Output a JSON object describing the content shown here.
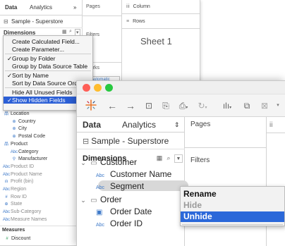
{
  "bg": {
    "tabs": {
      "data": "Data",
      "analytics": "Analytics",
      "arrow": "»",
      "pages": "Pages",
      "columns": "Column",
      "rows": "Rows"
    },
    "datasource": "Sample - Superstore",
    "dimensions": "Dimensions",
    "menu": [
      {
        "label": "Create Calculated Field...",
        "checked": false
      },
      {
        "label": "Create Parameter...",
        "checked": false
      },
      {
        "label": "Group by Folder",
        "checked": true
      },
      {
        "label": "Group by Data Source Table",
        "checked": false
      },
      {
        "label": "Sort by Name",
        "checked": true
      },
      {
        "label": "Sort by Data Source Order",
        "checked": false
      },
      {
        "label": "Hide All Unused Fields",
        "checked": false
      },
      {
        "label": "Show Hidden Fields",
        "checked": true
      }
    ],
    "check": "✓",
    "tree": [
      {
        "label": "Location",
        "icon": "品",
        "indent": 1
      },
      {
        "label": "Country",
        "icon": "⊕",
        "indent": 2
      },
      {
        "label": "City",
        "icon": "⊕",
        "indent": 2
      },
      {
        "label": "Postal Code",
        "icon": "⊕",
        "indent": 2
      },
      {
        "label": "Product",
        "icon": "品",
        "indent": 1
      },
      {
        "label": "Category",
        "icon": "Abc",
        "indent": 2
      },
      {
        "label": "Manufacturer",
        "icon": "⚲",
        "indent": 2
      },
      {
        "label": "Product ID",
        "icon": "Abc",
        "indent": 1,
        "hidden": true
      },
      {
        "label": "Product Name",
        "icon": "Abc",
        "indent": 1,
        "hidden": true
      },
      {
        "label": "Profit (bin)",
        "icon": "ılı",
        "indent": 1,
        "hidden": true
      },
      {
        "label": "Region",
        "icon": "Abc",
        "indent": 1,
        "hidden": true
      },
      {
        "label": "Row ID",
        "icon": "#",
        "indent": 1,
        "hidden": true
      },
      {
        "label": "State",
        "icon": "⊕",
        "indent": 1,
        "hidden": true
      },
      {
        "label": "Sub-Category",
        "icon": "Abc",
        "indent": 1,
        "hidden": true
      },
      {
        "label": "Measure Names",
        "icon": "Abc",
        "indent": 1,
        "hidden": true
      }
    ],
    "measures": "Measures",
    "discount": "Discount",
    "filters": "Filters",
    "marks": "Marks",
    "automatic": "Automatic",
    "sheet": "Sheet 1"
  },
  "fg": {
    "tabs": {
      "data": "Data",
      "analytics": "Analytics",
      "arrow": "⇕",
      "pages": "Pages"
    },
    "datasource": "Sample - Superstore",
    "dimensions": "Dimensions",
    "filters": "Filters",
    "tree": [
      {
        "label": "Customer",
        "type": "folder",
        "open": true
      },
      {
        "label": "Customer Name",
        "type": "abc"
      },
      {
        "label": "Segment",
        "type": "abc",
        "selected": true
      },
      {
        "label": "Order",
        "type": "folder",
        "open": true
      },
      {
        "label": "Order Date",
        "type": "date"
      },
      {
        "label": "Order ID",
        "type": "abc"
      }
    ],
    "abc": "Abc",
    "tool_grid": "▦",
    "tool_search": "⌕",
    "tool_dropdown": "▼",
    "right_glyph": "ii"
  },
  "context_menu": {
    "items": [
      {
        "label": "Rename",
        "state": "normal"
      },
      {
        "label": "Hide",
        "state": "disabled"
      },
      {
        "label": "Unhide",
        "state": "selected"
      }
    ]
  },
  "colors": {
    "close": "#fe5f57",
    "minimize": "#febc2e",
    "zoom": "#28c840",
    "selection": "#2b68d9"
  }
}
